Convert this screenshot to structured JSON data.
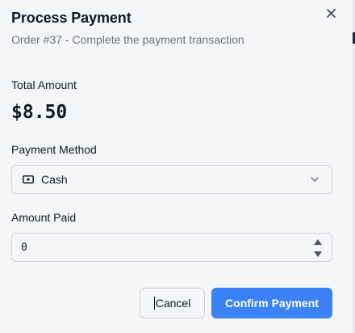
{
  "dialog": {
    "title": "Process Payment",
    "subtitle": "Order #37 - Complete the payment transaction"
  },
  "total": {
    "label": "Total Amount",
    "value": "$8.50"
  },
  "payment_method": {
    "label": "Payment Method",
    "selected": "Cash",
    "icon": "cash-icon"
  },
  "amount_paid": {
    "label": "Amount Paid",
    "value": "0"
  },
  "actions": {
    "cancel_label": "Cancel",
    "confirm_label": "Confirm Payment"
  },
  "colors": {
    "primary": "#3b82f6",
    "background": "#f5f6f8",
    "muted_text": "#6b7280",
    "border": "#d1d5db"
  }
}
